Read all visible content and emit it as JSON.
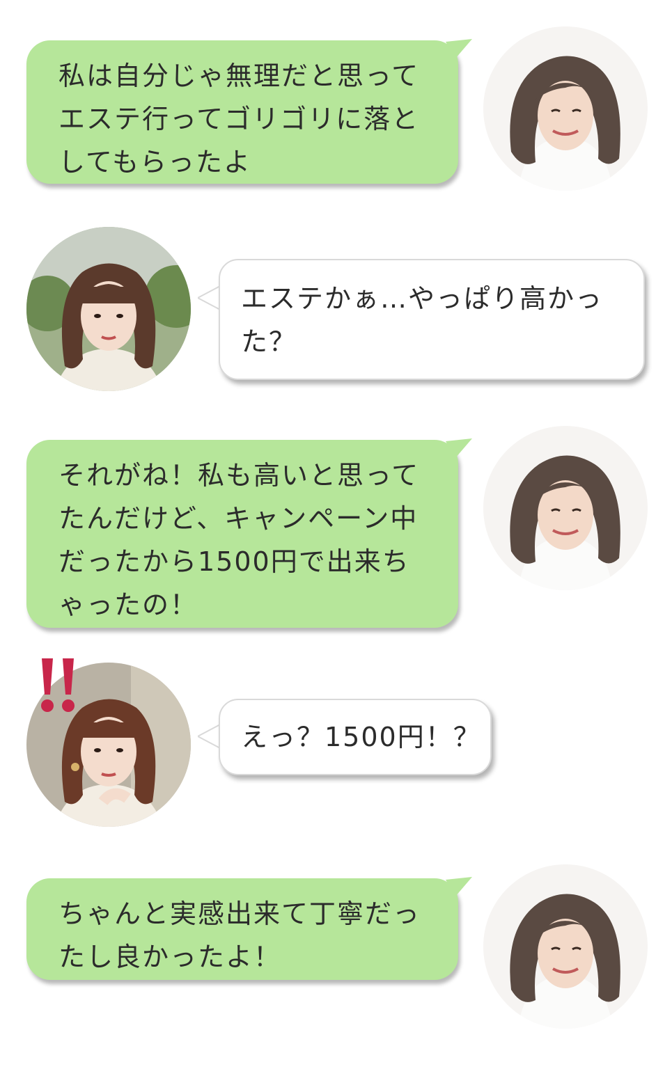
{
  "conversation": {
    "messages": [
      {
        "speaker": "right",
        "lines": [
          "私は自分じゃ無理だと思って",
          "エステ行ってゴリゴリに落と",
          "してもらったよ"
        ]
      },
      {
        "speaker": "left",
        "lines": [
          "エステかぁ…やっぱり高かっ",
          "た？"
        ]
      },
      {
        "speaker": "right",
        "lines": [
          "それがね！私も高いと思って",
          "たんだけど、キャンペーン中",
          "だったから1500円で出来ち",
          "ゃったの！"
        ]
      },
      {
        "speaker": "left",
        "lines": [
          "えっ？1500円！？"
        ]
      },
      {
        "speaker": "right",
        "lines": [
          "ちゃんと実感出来て丁寧だっ",
          "たし良かったよ！"
        ]
      }
    ]
  },
  "colors": {
    "green_bubble": "#b6e69a",
    "white_bubble": "#ffffff",
    "exclaim": "#c8264a"
  },
  "icons": {
    "right_avatar": "woman-avatar-icon",
    "left_avatar": "girl-avatar-icon",
    "surprise": "double-exclamation-icon"
  }
}
